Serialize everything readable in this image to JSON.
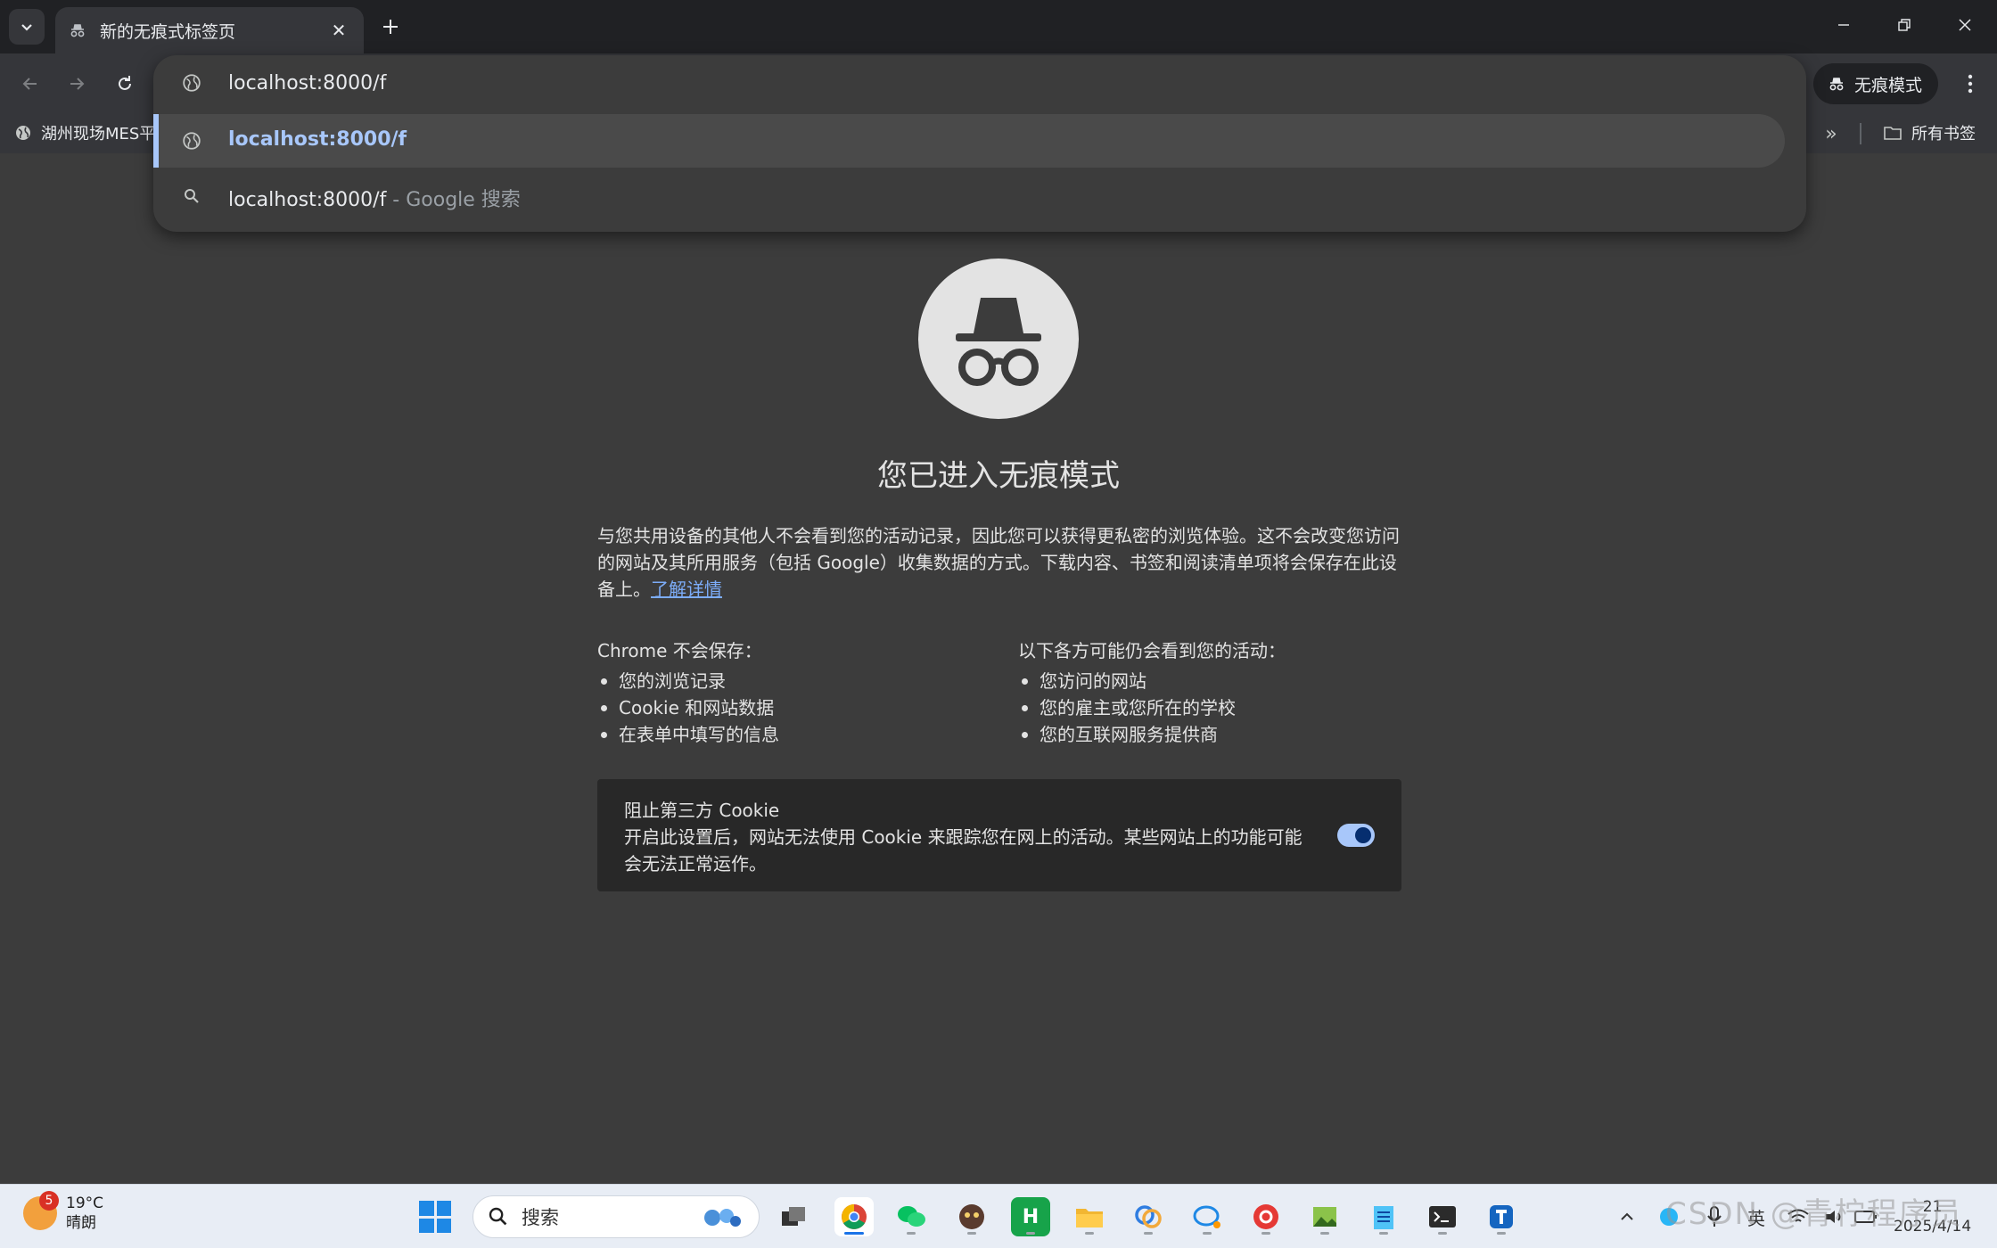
{
  "tab": {
    "title": "新的无痕式标签页",
    "close_glyph": "✕"
  },
  "window_controls": {
    "minimize": "—",
    "restore": "❐",
    "close": "✕"
  },
  "toolbar": {
    "incognito_label": "无痕模式",
    "icons": [
      "back-arrow-icon",
      "forward-arrow-icon",
      "reload-icon",
      "more-vert-icon"
    ]
  },
  "bookmarks": {
    "first_item": "湖州现场MES平",
    "overflow_glyph": "»",
    "all_bookmarks": "所有书签"
  },
  "omnibox": {
    "input_value": "localhost:8000/f",
    "suggestions": [
      {
        "text": "localhost:8000/f",
        "suffix": "",
        "icon": "globe-icon",
        "selected": true
      },
      {
        "text": "localhost:8000/f",
        "suffix": " - Google 搜索",
        "icon": "search-icon",
        "selected": false
      }
    ]
  },
  "ntp": {
    "heading": "您已进入无痕模式",
    "description": "与您共用设备的其他人不会看到您的活动记录，因此您可以获得更私密的浏览体验。这不会改变您访问的网站及其所用服务（包括 Google）收集数据的方式。下载内容、书签和阅读清单项将会保存在此设备上。",
    "learn_more": "了解详情",
    "not_saved": {
      "title": "Chrome 不会保存：",
      "items": [
        "您的浏览记录",
        "Cookie 和网站数据",
        "在表单中填写的信息"
      ]
    },
    "may_see": {
      "title": "以下各方可能仍会看到您的活动：",
      "items": [
        "您访问的网站",
        "您的雇主或您所在的学校",
        "您的互联网服务提供商"
      ]
    },
    "cookie_card": {
      "title": "阻止第三方 Cookie",
      "description": "开启此设置后，网站无法使用 Cookie 来跟踪您在网上的活动。某些网站上的功能可能会无法正常运作。",
      "enabled": true
    }
  },
  "taskbar": {
    "weather_badge": "5",
    "weather_temp": "19°C",
    "weather_cond": "晴朗",
    "search_placeholder": "搜索",
    "app_h_label": "H",
    "tray_lang": "英",
    "tray_time": "21",
    "tray_date": "2025/4/14",
    "watermark": "CSDN @青柠程序员"
  },
  "colors": {
    "frame": "#202124",
    "toolbar": "#35363a",
    "page_bg": "#3c3c3c",
    "accent": "#a8c7fa",
    "link": "#7cacf8"
  }
}
